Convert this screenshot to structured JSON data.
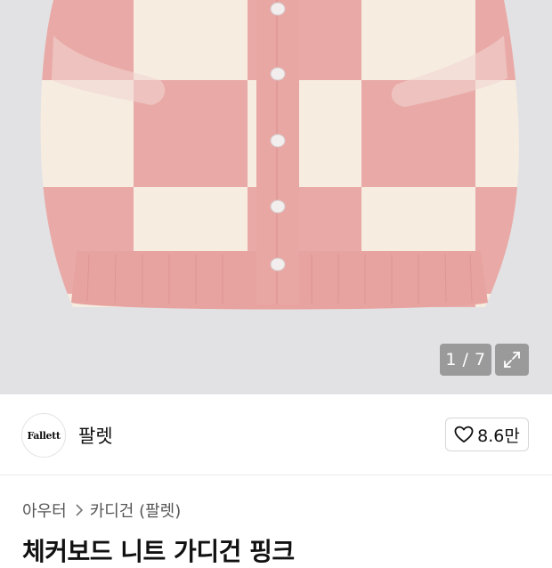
{
  "gallery": {
    "counter": "1 / 7",
    "expand_icon": "expand-icon"
  },
  "brand": {
    "logo_text": "Fallett",
    "name": "팔렛"
  },
  "like": {
    "icon": "heart-icon",
    "count": "8.6만"
  },
  "breadcrumb": {
    "category": "아우터",
    "subcategory": "카디건 (팔렛)"
  },
  "product": {
    "title": "체커보드 니트 가디건 핑크"
  },
  "colors": {
    "pink": "#e9a7a4",
    "cream": "#f6ecdf",
    "gallery_bg": "#e2e2e4"
  }
}
